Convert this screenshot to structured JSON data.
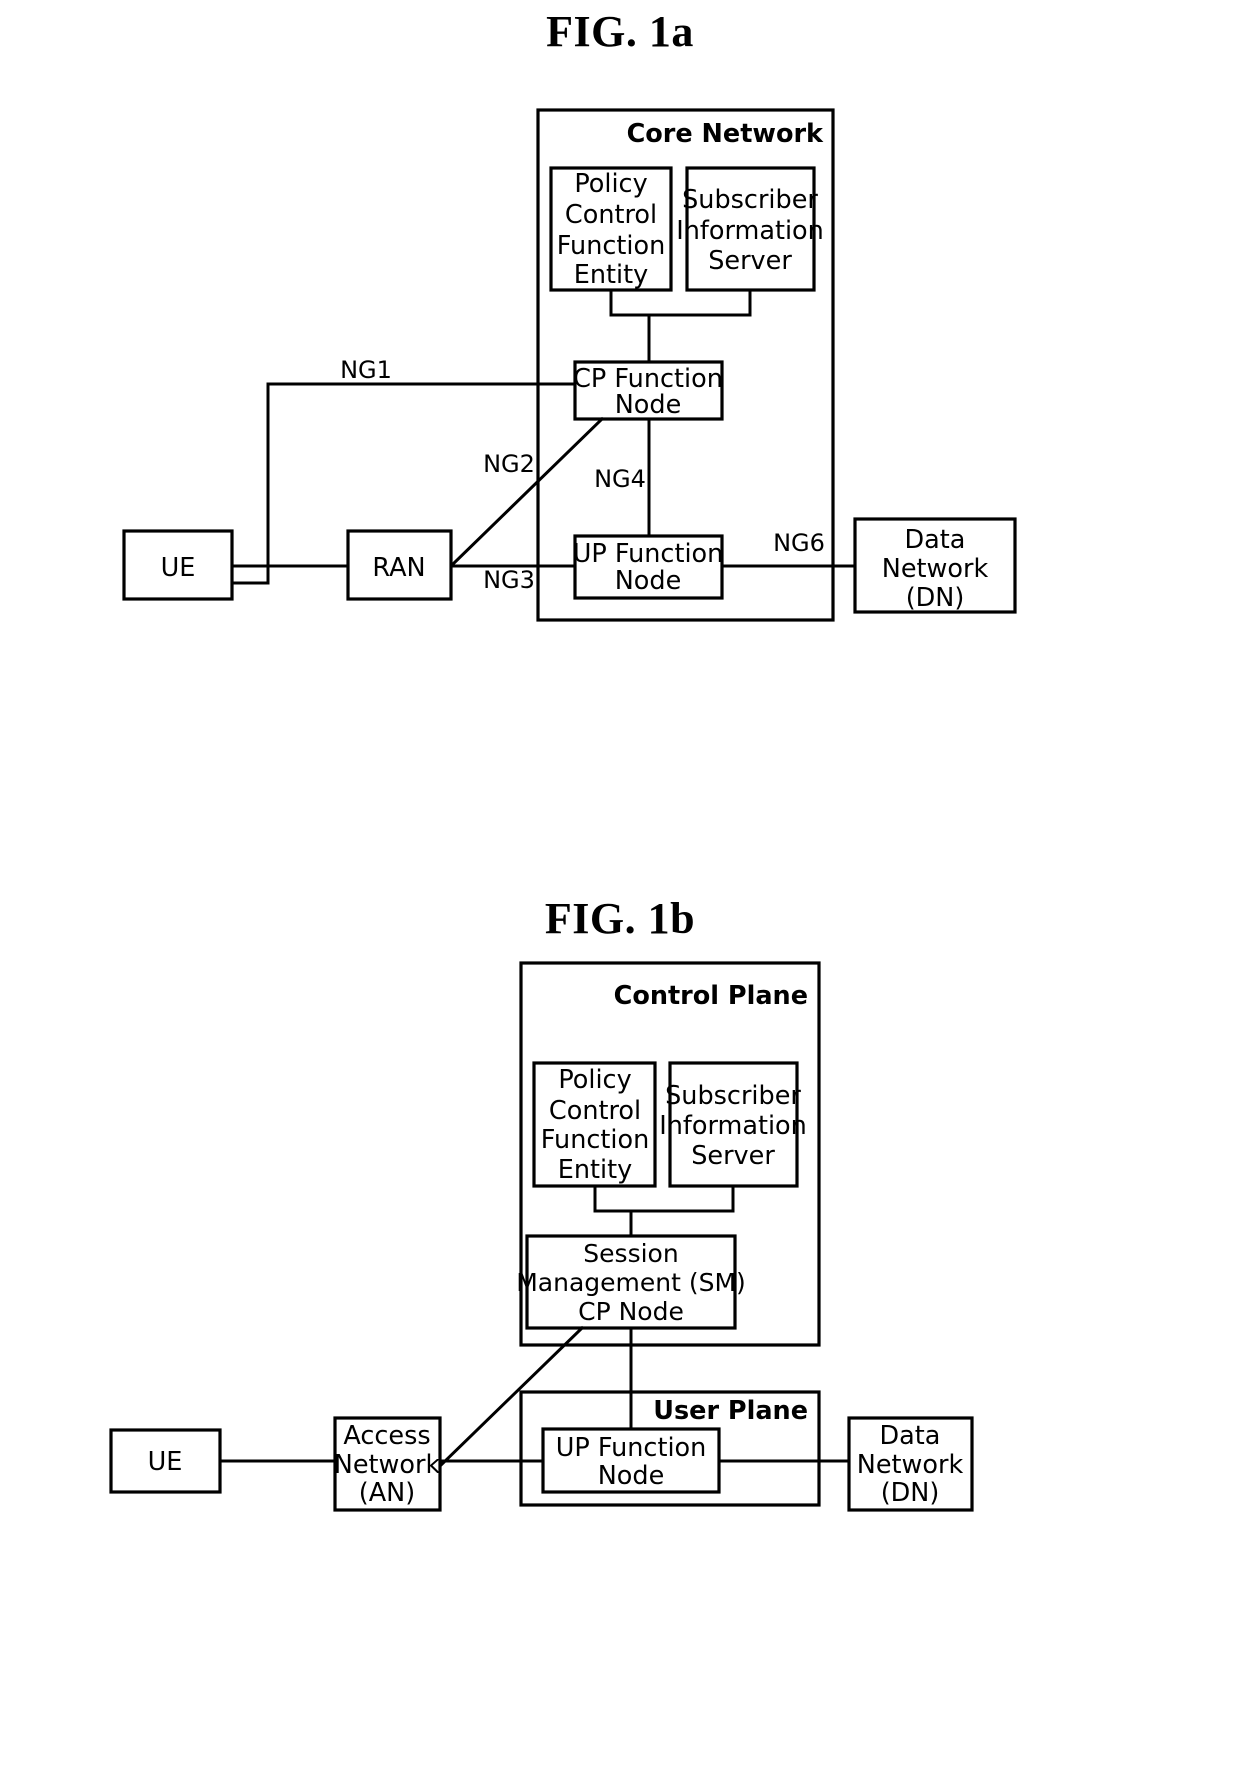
{
  "figures": [
    {
      "id": "fig1a",
      "title": "FIG. 1a",
      "container": {
        "label": "Core Network"
      },
      "nodes": {
        "ue": "UE",
        "ran": "RAN",
        "policy": [
          "Policy",
          "Control",
          "Function",
          "Entity"
        ],
        "subscriber": [
          "Subscriber",
          "Information",
          "Server"
        ],
        "cp": [
          "CP Function",
          "Node"
        ],
        "up": [
          "UP Function",
          "Node"
        ],
        "dn": [
          "Data",
          "Network",
          "(DN)"
        ]
      },
      "edges": {
        "ng1": "NG1",
        "ng2": "NG2",
        "ng3": "NG3",
        "ng4": "NG4",
        "ng6": "NG6"
      }
    },
    {
      "id": "fig1b",
      "title": "FIG. 1b",
      "containers": {
        "control_plane": "Control Plane",
        "user_plane": "User Plane"
      },
      "nodes": {
        "ue": "UE",
        "an": [
          "Access",
          "Network",
          "(AN)"
        ],
        "policy": [
          "Policy",
          "Control",
          "Function",
          "Entity"
        ],
        "subscriber": [
          "Subscriber",
          "Information",
          "Server"
        ],
        "sm": [
          "Session",
          "Management (SM)",
          "CP Node"
        ],
        "up": [
          "UP Function",
          "Node"
        ],
        "dn": [
          "Data",
          "Network",
          "(DN)"
        ]
      }
    }
  ],
  "style": {
    "line_color": "#000000",
    "background": "#ffffff"
  }
}
